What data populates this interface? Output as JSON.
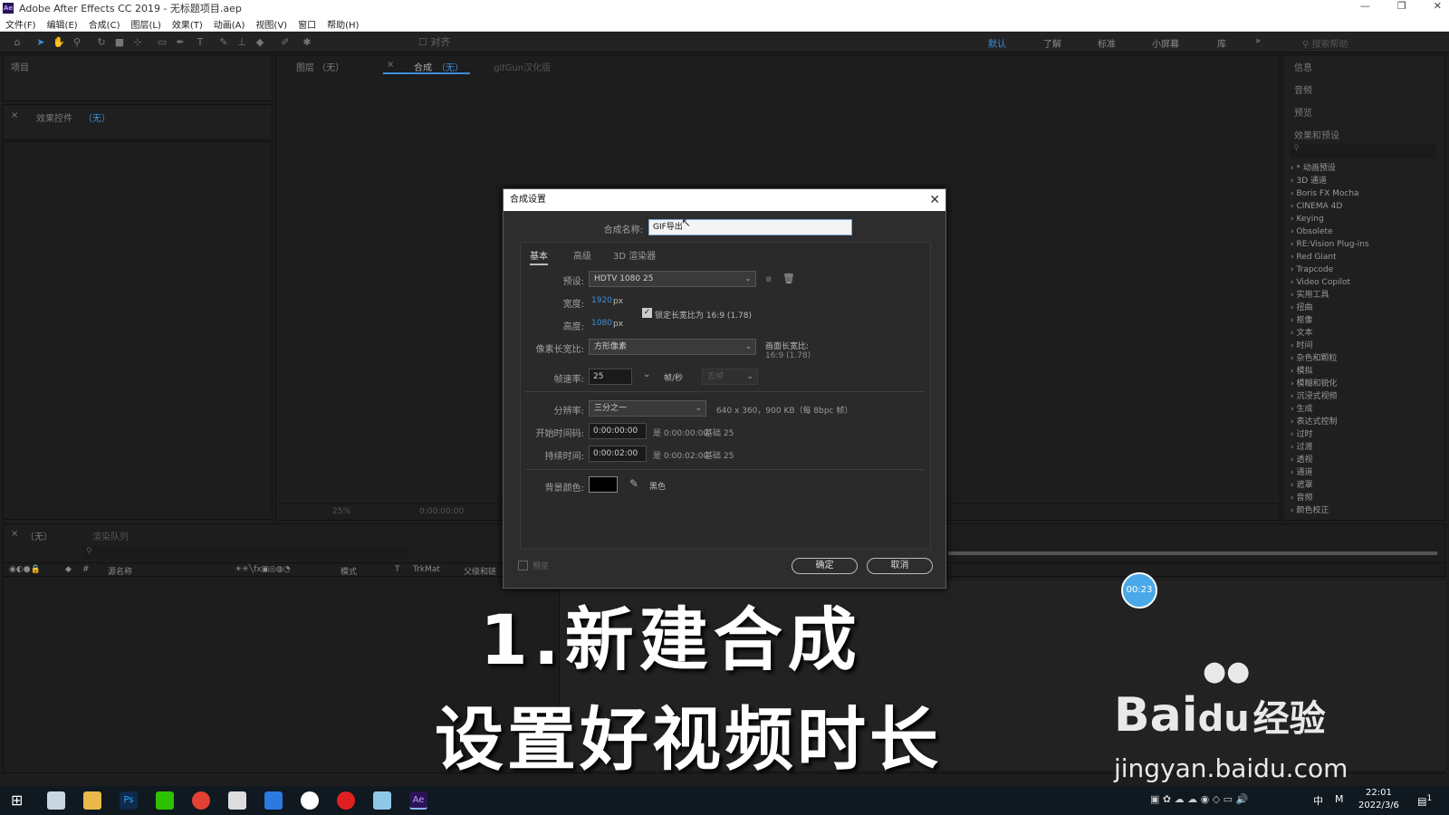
{
  "window": {
    "title": "Adobe After Effects CC 2019 - 无标题项目.aep",
    "app_icon": "Ae"
  },
  "menu": [
    "文件(F)",
    "编辑(E)",
    "合成(C)",
    "图层(L)",
    "效果(T)",
    "动画(A)",
    "视图(V)",
    "窗口",
    "帮助(H)"
  ],
  "toolbar": {
    "snap_label": "对齐",
    "workspaces": [
      "默认",
      "了解",
      "标准",
      "小屏幕",
      "库"
    ],
    "search_placeholder": "搜索帮助"
  },
  "panels": {
    "project_tab": "项目",
    "effect_controls_tab": "效果控件",
    "effect_controls_none": "（无）",
    "layer_tab": "图层 （无）",
    "comp_tab": "合成",
    "comp_tab_none": "（无）",
    "gifgun_tab": "gifGun汉化版",
    "viewer_zoom": "25%",
    "viewer_time": "0:00:00:00",
    "right_tabs": [
      "信息",
      "音频",
      "预览",
      "效果和预设"
    ],
    "effects": [
      "* 动画预设",
      "3D 通道",
      "Boris FX Mocha",
      "CINEMA 4D",
      "Keying",
      "Obsolete",
      "RE:Vision Plug-ins",
      "Red Giant",
      "Trapcode",
      "Video Copilot",
      "实用工具",
      "扭曲",
      "抠像",
      "文本",
      "时间",
      "杂色和颗粒",
      "模拟",
      "模糊和锐化",
      "沉浸式视频",
      "生成",
      "表达式控制",
      "过时",
      "过渡",
      "透视",
      "通道",
      "遮罩",
      "音频",
      "颜色校正"
    ]
  },
  "timeline": {
    "tab": "（无）",
    "render_queue_tab": "渲染队列",
    "columns": [
      "#",
      "源名称",
      "模式",
      "T",
      "TrkMat",
      "父级和链"
    ],
    "time_badge": "00:23"
  },
  "dialog": {
    "title": "合成设置",
    "name_label": "合成名称:",
    "name_value": "GIF导出",
    "tabs": [
      "基本",
      "高级",
      "3D 渲染器"
    ],
    "preset_label": "预设:",
    "preset_value": "HDTV 1080 25",
    "width_label": "宽度:",
    "width_value": "1920",
    "height_label": "高度:",
    "height_value": "1080",
    "unit_px": "px",
    "lock_aspect_label": "锁定长宽比为 16:9 (1.78)",
    "lock_aspect_checked": true,
    "pixel_aspect_label": "像素长宽比:",
    "pixel_aspect_value": "方形像素",
    "frame_aspect_label": "画面长宽比:",
    "frame_aspect_value": "16:9 (1.78)",
    "frame_rate_label": "帧速率:",
    "frame_rate_value": "25",
    "fps_unit": "帧/秒",
    "drop_frame_value": "丢帧",
    "resolution_label": "分辨率:",
    "resolution_value": "三分之一",
    "resolution_info": "640 x 360，900 KB（每 8bpc 帧）",
    "start_tc_label": "开始时间码:",
    "start_tc_value": "0:00:00:00",
    "start_tc_info": "是 0:00:00:00",
    "start_tc_base": "基础 25",
    "duration_label": "持续时间:",
    "duration_value": "0:00:02:00",
    "duration_info": "是 0:00:02:00",
    "duration_base": "基础 25",
    "bg_color_label": "背景颜色:",
    "bg_color_name": "黑色",
    "bg_color": "#000000",
    "preview_label": "预览",
    "ok_label": "确定",
    "cancel_label": "取消"
  },
  "overlay": {
    "line1": "1.新建合成",
    "line2": "设置好视频时长",
    "watermark_brand": "Bai",
    "watermark_du": "du",
    "watermark_cn": "经验",
    "watermark_url": "jingyan.baidu.com"
  },
  "taskbar": {
    "time": "22:01",
    "date": "2022/3/6",
    "ime": "中",
    "notif_count": "1"
  }
}
